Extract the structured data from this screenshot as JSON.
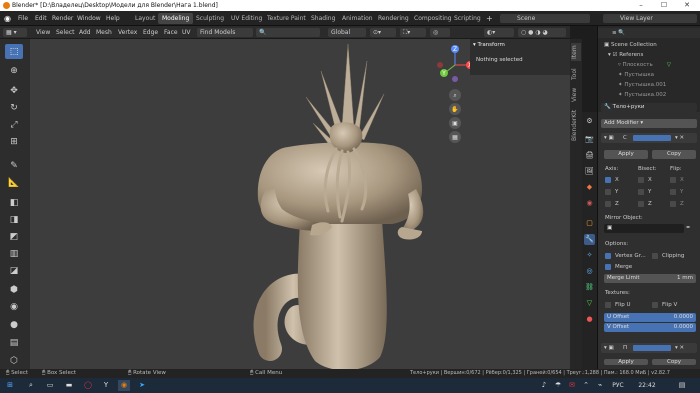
{
  "title": "Blender* [D:\\Владелец\\Desktop\\Модели для Blender\\Нага 1.blend]",
  "menu": [
    "File",
    "Edit",
    "Render",
    "Window",
    "Help"
  ],
  "workspaces": [
    "Layout",
    "Modeling",
    "Sculpting",
    "UV Editing",
    "Texture Paint",
    "Shading",
    "Animation",
    "Rendering",
    "Compositing",
    "Scripting"
  ],
  "active_workspace": "Modeling",
  "scene": "Scene",
  "view_layer": "View Layer",
  "viewport_header": {
    "menus": [
      "View",
      "Select",
      "Add",
      "Mesh",
      "Vertex",
      "Edge",
      "Face",
      "UV"
    ],
    "find_models": "Find Models",
    "orientation": "Global"
  },
  "npanel": {
    "section": "Transform",
    "status": "Nothing selected"
  },
  "npanel_tabs": [
    "Item",
    "Tool",
    "View",
    "BlenderKit"
  ],
  "outliner": {
    "root": "Scene Collection",
    "items": [
      "Referens",
      "Плоскость",
      "Пустышка",
      "Пустышка.001",
      "Пустышка.002"
    ]
  },
  "properties": {
    "object_name": "Тело+руки",
    "add_modifier": "Add Modifier",
    "modifier_short": "C",
    "apply": "Apply",
    "copy": "Copy",
    "axis_label": "Axis:",
    "bisect_label": "Bisect:",
    "flip_label": "Flip:",
    "axes": [
      "X",
      "Y",
      "Z"
    ],
    "mirror_object": "Mirror Object:",
    "options": "Options:",
    "vertex_groups": "Vertex Gr...",
    "clipping": "Clipping",
    "merge": "Merge",
    "merge_limit_label": "Merge Limit",
    "merge_limit_value": "1 mm",
    "textures": "Textures:",
    "flip_u": "Flip U",
    "flip_v": "Flip V",
    "u_offset": "U Offset",
    "u_offset_value": "0.0000",
    "v_offset": "V Offset",
    "v_offset_value": "0.0000",
    "modifier2_short": "П"
  },
  "statusbar": {
    "select": "Select",
    "box_select": "Box Select",
    "rotate_view": "Rotate View",
    "call_menu": "Call Menu",
    "stats": "Тело+руки | Вершин:0/672 | Рёбер:0/1,325 | Граней:0/654 | Треуг.:1,288 | Пам.: 168.0 МиБ | v2.82.7"
  },
  "taskbar": {
    "lang": "РУС",
    "time": "22:42"
  }
}
